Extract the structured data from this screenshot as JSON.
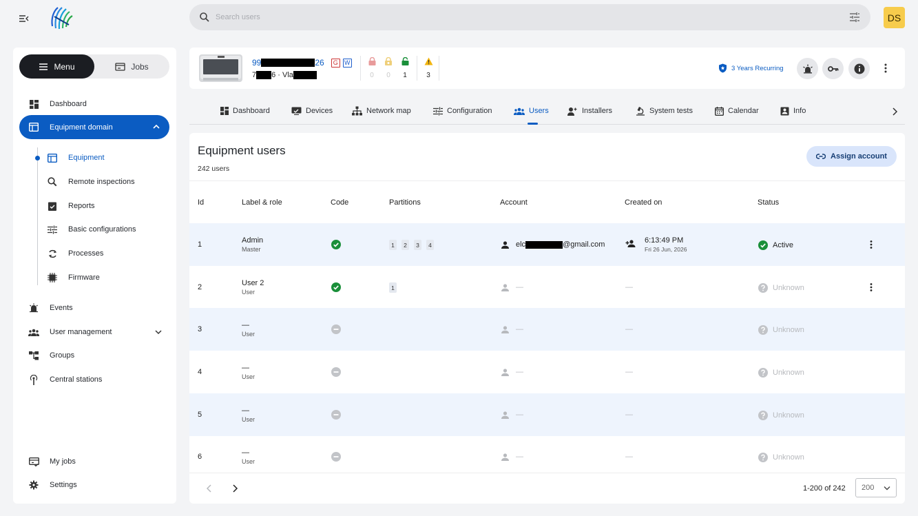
{
  "topbar": {
    "search_placeholder": "Search users",
    "avatar_initials": "DS"
  },
  "sidebar": {
    "menu_label": "Menu",
    "jobs_label": "Jobs",
    "items": [
      {
        "label": "Dashboard",
        "icon": "dashboard-icon"
      },
      {
        "label": "Equipment domain",
        "icon": "equipment-domain-icon"
      },
      {
        "label": "Events",
        "icon": "alarm-icon"
      },
      {
        "label": "User management",
        "icon": "users-icon"
      },
      {
        "label": "Groups",
        "icon": "groups-icon"
      },
      {
        "label": "Central stations",
        "icon": "antenna-icon"
      }
    ],
    "subitems": [
      {
        "label": "Equipment",
        "icon": "equipment-icon"
      },
      {
        "label": "Remote inspections",
        "icon": "inspection-icon"
      },
      {
        "label": "Reports",
        "icon": "reports-icon"
      },
      {
        "label": "Basic configurations",
        "icon": "config-icon"
      },
      {
        "label": "Processes",
        "icon": "processes-icon"
      },
      {
        "label": "Firmware",
        "icon": "firmware-icon"
      }
    ],
    "bottom": [
      {
        "label": "My jobs",
        "icon": "my-jobs-icon"
      },
      {
        "label": "Settings",
        "icon": "gear-icon"
      }
    ]
  },
  "device": {
    "id_prefix": "99",
    "id_suffix": "26",
    "tag_g": "G",
    "tag_w": "W",
    "sub_prefix": "7",
    "sub_mid": "6 · Vla",
    "locks": [
      {
        "count": "0",
        "color": "#e89b9b",
        "icon": "lock-icon"
      },
      {
        "count": "0",
        "color": "#efcf7a",
        "icon": "partial-lock-icon"
      },
      {
        "count": "1",
        "color": "#1a8f3a",
        "icon": "unlock-icon"
      }
    ],
    "warning_count": "3",
    "license": "3 Years Recurring"
  },
  "tabs": [
    {
      "label": "Dashboard",
      "icon": "dashboard-icon"
    },
    {
      "label": "Devices",
      "icon": "devices-icon"
    },
    {
      "label": "Network map",
      "icon": "network-icon"
    },
    {
      "label": "Configuration",
      "icon": "config-icon"
    },
    {
      "label": "Users",
      "icon": "users-icon"
    },
    {
      "label": "Installers",
      "icon": "installer-icon"
    },
    {
      "label": "System tests",
      "icon": "microscope-icon"
    },
    {
      "label": "Calendar",
      "icon": "calendar-icon"
    },
    {
      "label": "Info",
      "icon": "info-card-icon"
    }
  ],
  "table": {
    "title": "Equipment users",
    "count": "242 users",
    "assign_label": "Assign account",
    "headers": [
      "Id",
      "Label & role",
      "Code",
      "Partitions",
      "Account",
      "Created on",
      "Status"
    ],
    "rows": [
      {
        "id": "1",
        "label": "Admin",
        "role": "Master",
        "code": "ok",
        "partitions": [
          "1",
          "2",
          "3",
          "4"
        ],
        "account_prefix": "elc",
        "account_suffix": "@gmail.com",
        "created_time": "6:13:49 PM",
        "created_date": "Fri 26 Jun, 2026",
        "status": "Active"
      },
      {
        "id": "2",
        "label": "User 2",
        "role": "User",
        "code": "ok",
        "partitions": [
          "1"
        ],
        "account": "—",
        "created": "—",
        "status": "Unknown"
      },
      {
        "id": "3",
        "label": "—",
        "role": "User",
        "code": "none",
        "partitions": [],
        "account": "—",
        "created": "—",
        "status": "Unknown"
      },
      {
        "id": "4",
        "label": "—",
        "role": "User",
        "code": "none",
        "partitions": [],
        "account": "—",
        "created": "—",
        "status": "Unknown"
      },
      {
        "id": "5",
        "label": "—",
        "role": "User",
        "code": "none",
        "partitions": [],
        "account": "—",
        "created": "—",
        "status": "Unknown"
      },
      {
        "id": "6",
        "label": "—",
        "role": "User",
        "code": "none",
        "partitions": [],
        "account": "—",
        "created": "—",
        "status": "Unknown"
      }
    ],
    "range": "1-200 of 242",
    "page_size": "200"
  },
  "colors": {
    "accent": "#0b5cc2",
    "success": "#1a8f3a",
    "muted": "#b7b9bd"
  }
}
